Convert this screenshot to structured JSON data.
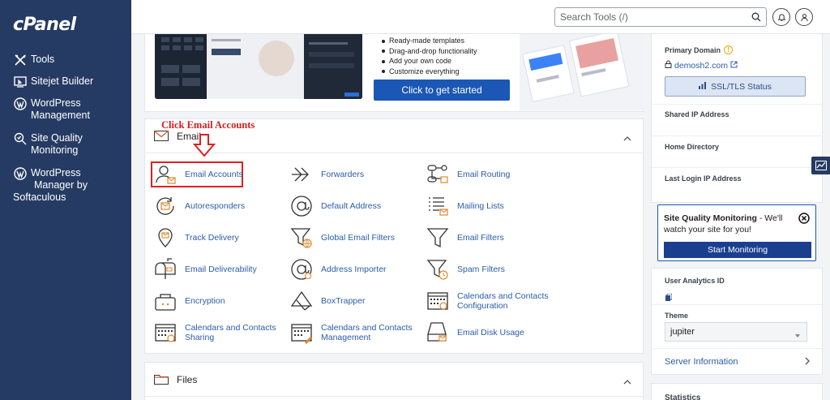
{
  "app": {
    "logo": "cPanel"
  },
  "sidebar": {
    "items": [
      {
        "label": "Tools",
        "icon": "tools-icon"
      },
      {
        "label": "Sitejet Builder",
        "icon": "sitejet-icon"
      },
      {
        "label": "WordPress Management",
        "label_lines": [
          "WordPress",
          "Management"
        ],
        "icon": "wordpress-icon"
      },
      {
        "label": "Site Quality Monitoring",
        "label_lines": [
          "Site Quality",
          "Monitoring"
        ],
        "icon": "search-check-icon"
      },
      {
        "label": "WordPress Manager by Softaculous",
        "label_lines": [
          "WordPress",
          "Manager by",
          "Softaculous"
        ],
        "icon": "wordpress-icon"
      }
    ]
  },
  "topbar": {
    "search_placeholder": "Search Tools (/)"
  },
  "sitejet": {
    "bullets": [
      "Ready-made templates",
      "Drag-and-drop functionality",
      "Add your own code",
      "Customize everything"
    ],
    "cta": "Click to get started"
  },
  "email": {
    "title": "Email",
    "annotation": "Click Email Accounts",
    "tools": [
      {
        "label": "Email Accounts",
        "icon": "email-accounts-icon"
      },
      {
        "label": "Forwarders",
        "icon": "forwarders-icon"
      },
      {
        "label": "Email Routing",
        "icon": "email-routing-icon"
      },
      {
        "label": "Autoresponders",
        "icon": "autoresponders-icon"
      },
      {
        "label": "Default Address",
        "icon": "at-sign-icon"
      },
      {
        "label": "Mailing Lists",
        "icon": "mailing-lists-icon"
      },
      {
        "label": "Track Delivery",
        "icon": "track-delivery-icon"
      },
      {
        "label": "Global Email Filters",
        "icon": "global-filter-icon"
      },
      {
        "label": "Email Filters",
        "icon": "filter-icon"
      },
      {
        "label": "Email Deliverability",
        "icon": "mailbox-icon"
      },
      {
        "label": "Address Importer",
        "icon": "address-importer-icon"
      },
      {
        "label": "Spam Filters",
        "icon": "spam-filter-icon"
      },
      {
        "label": "Encryption",
        "icon": "encryption-icon"
      },
      {
        "label": "BoxTrapper",
        "icon": "boxtrapper-icon"
      },
      {
        "label": "Calendars and Contacts Configuration",
        "label_lines": [
          "Calendars and Contacts",
          "Configuration"
        ],
        "icon": "calendar-config-icon"
      },
      {
        "label": "Calendars and Contacts Sharing",
        "label_lines": [
          "Calendars and Contacts",
          "Sharing"
        ],
        "icon": "calendar-sharing-icon"
      },
      {
        "label": "Calendars and Contacts Management",
        "label_lines": [
          "Calendars and Contacts",
          "Management"
        ],
        "icon": "calendar-management-icon"
      },
      {
        "label": "Email Disk Usage",
        "icon": "disk-usage-icon"
      }
    ]
  },
  "files": {
    "title": "Files"
  },
  "right": {
    "primary_domain_label": "Primary Domain",
    "primary_domain": "demosh2.com",
    "ssl_button": "SSL/TLS Status",
    "shared_ip_label": "Shared IP Address",
    "home_dir_label": "Home Directory",
    "last_login_label": "Last Login IP Address",
    "sq": {
      "title": "Site Quality Monitoring",
      "text": " - We'll watch your site for you!",
      "button": "Start Monitoring"
    },
    "analytics_label": "User Analytics ID",
    "theme_label": "Theme",
    "theme_value": "jupiter",
    "server_info": "Server Information",
    "statistics": "Statistics"
  },
  "colors": {
    "sidebar": "#263b63",
    "accent": "#1b57b5",
    "link": "#2b5ca8",
    "annotation": "#e02020",
    "icon_orange": "#e0882b"
  }
}
